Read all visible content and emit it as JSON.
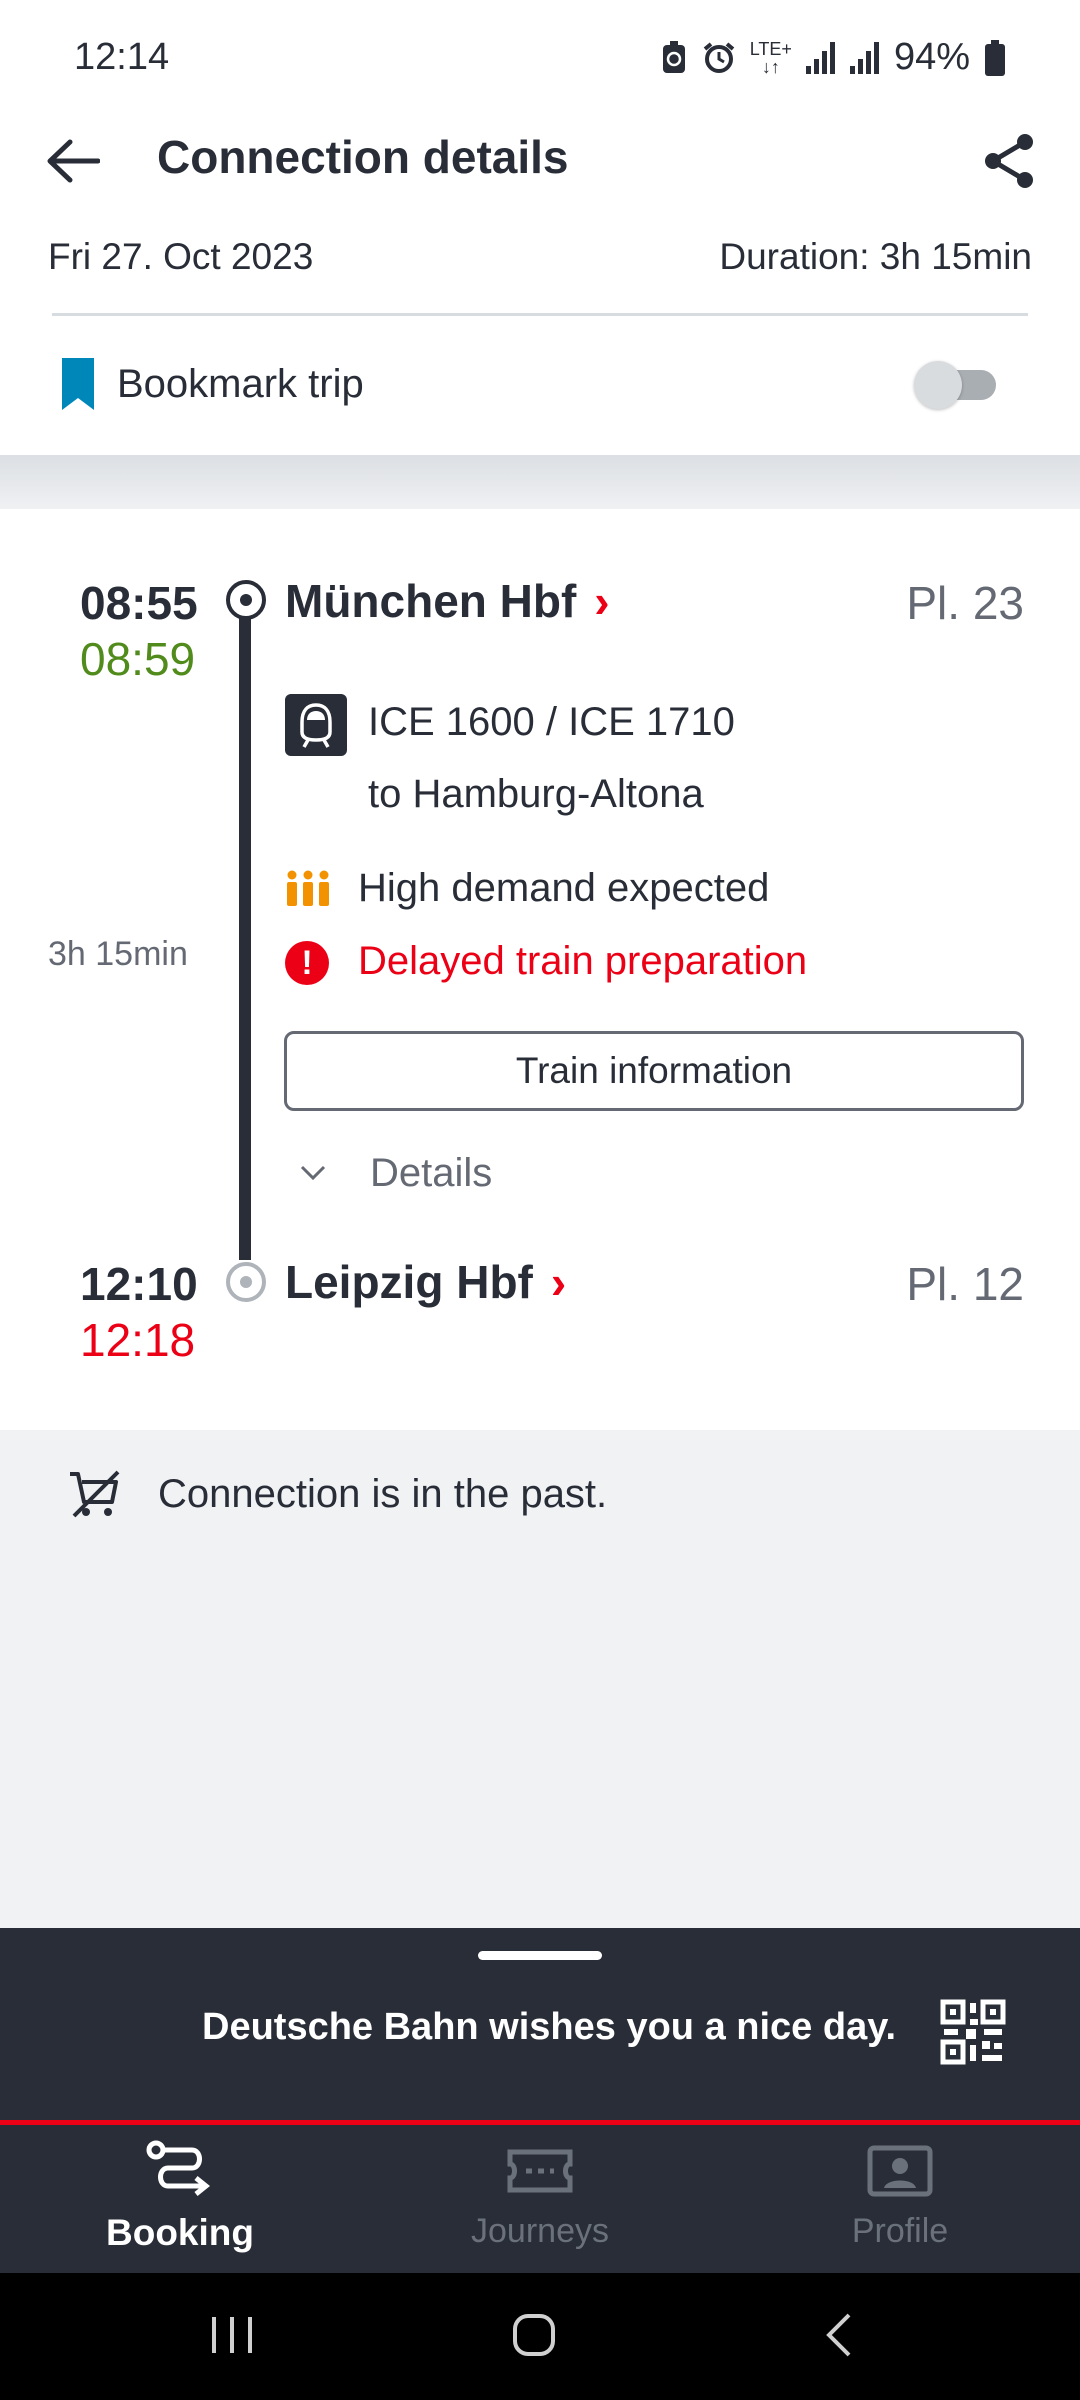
{
  "status_bar": {
    "time": "12:14",
    "network": "LTE+",
    "battery": "94%",
    "icons": [
      "battery-saver-icon",
      "alarm-icon",
      "lte-icon",
      "signal-icon",
      "signal-icon",
      "battery-icon"
    ]
  },
  "header": {
    "title": "Connection details",
    "back_icon": "arrow-left-icon",
    "share_icon": "share-icon"
  },
  "trip": {
    "date": "Fri 27. Oct 2023",
    "duration": "Duration: 3h 15min"
  },
  "bookmark": {
    "label": "Bookmark trip",
    "enabled": false
  },
  "departure": {
    "time_planned": "08:55",
    "time_actual": "08:59",
    "station": "München Hbf",
    "platform": "Pl. 23"
  },
  "arrival": {
    "time_planned": "12:10",
    "time_actual": "12:18",
    "station": "Leipzig Hbf",
    "platform": "Pl. 12"
  },
  "leg": {
    "duration": "3h 15min",
    "train": "ICE 1600 / ICE 1710",
    "destination": "to Hamburg-Altona",
    "demand": "High demand expected",
    "delay_notice": "Delayed train preparation",
    "train_info_button": "Train information",
    "details_label": "Details"
  },
  "notice": {
    "text": "Connection is in the past."
  },
  "bottom_panel": {
    "greeting": "Deutsche Bahn wishes you a nice day."
  },
  "nav": {
    "items": [
      {
        "label": "Booking",
        "icon": "route-icon",
        "active": true
      },
      {
        "label": "Journeys",
        "icon": "ticket-icon",
        "active": false
      },
      {
        "label": "Profile",
        "icon": "profile-card-icon",
        "active": false
      }
    ]
  },
  "colors": {
    "text": "#282d37",
    "on_time": "#508b1b",
    "delay": "#ec0016",
    "bookmark": "#0087b9",
    "demand": "#f39200",
    "panel": "#282d37"
  }
}
